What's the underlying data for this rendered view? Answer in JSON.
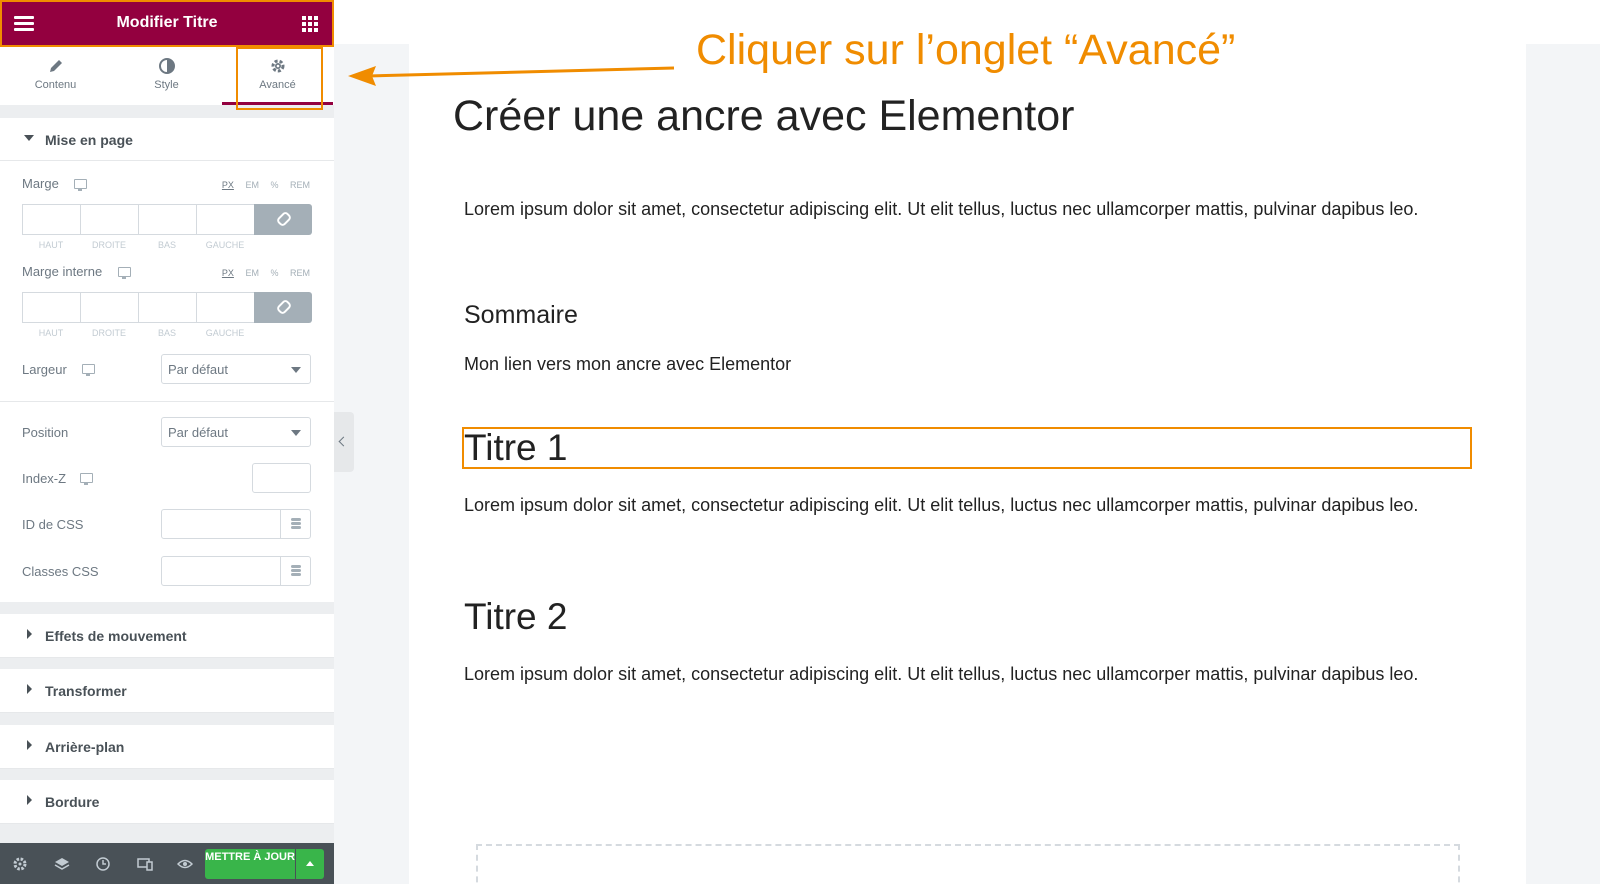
{
  "sidebar": {
    "title": "Modifier Titre",
    "tabs": [
      {
        "label": "Contenu",
        "icon": "pencil-icon"
      },
      {
        "label": "Style",
        "icon": "contrast-icon"
      },
      {
        "label": "Avancé",
        "icon": "gear-icon",
        "active": true
      }
    ],
    "layout_section": {
      "title": "Mise en page",
      "margin": {
        "label": "Marge",
        "units": [
          "PX",
          "EM",
          "%",
          "REM"
        ],
        "selected_unit": "PX",
        "sides": [
          "HAUT",
          "DROITE",
          "BAS",
          "GAUCHE"
        ]
      },
      "padding": {
        "label": "Marge interne",
        "units": [
          "PX",
          "EM",
          "%",
          "REM"
        ],
        "selected_unit": "PX",
        "sides": [
          "HAUT",
          "DROITE",
          "BAS",
          "GAUCHE"
        ]
      },
      "width": {
        "label": "Largeur",
        "value": "Par défaut"
      },
      "position": {
        "label": "Position",
        "value": "Par défaut"
      },
      "zindex": {
        "label": "Index-Z",
        "value": ""
      },
      "css_id": {
        "label": "ID de CSS",
        "value": ""
      },
      "css_classes": {
        "label": "Classes CSS",
        "value": ""
      }
    },
    "collapsed_sections": [
      "Effets de mouvement",
      "Transformer",
      "Arrière-plan",
      "Bordure"
    ],
    "footer": {
      "icons": [
        "settings-icon",
        "layers-icon",
        "history-icon",
        "responsive-icon",
        "preview-icon"
      ],
      "update_label": "METTRE À JOUR"
    }
  },
  "annotation": {
    "text": "Cliquer sur l’onglet “Avancé”",
    "color": "#f08c00"
  },
  "content": {
    "title": "Créer une ancre avec Elementor",
    "paragraph": "Lorem ipsum dolor sit amet, consectetur adipiscing elit. Ut elit tellus, luctus nec ullamcorper mattis, pulvinar dapibus leo.",
    "summary_heading": "Sommaire",
    "summary_link": "Mon lien vers mon ancre avec Elementor",
    "heading1": "Titre 1",
    "heading2": "Titre 2"
  },
  "colors": {
    "brand": "#93003f",
    "highlight": "#f08c00",
    "update_button": "#39b54a"
  }
}
